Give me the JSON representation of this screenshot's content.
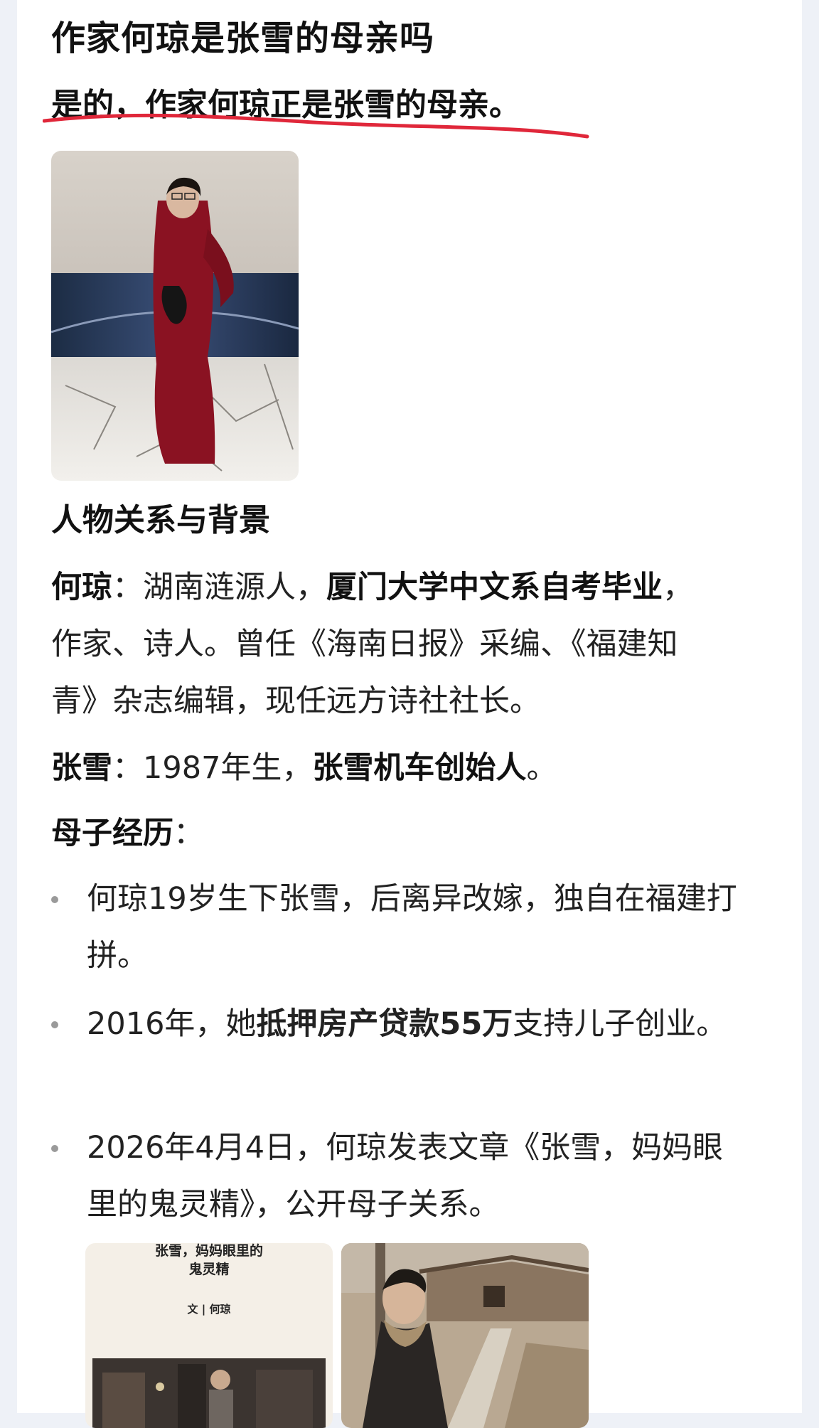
{
  "question": "作家何琼是张雪的母亲吗",
  "answer": "是的，作家何琼正是张雪的母亲。",
  "section_title": "人物关系与背景",
  "he_qiong": {
    "name": "何琼",
    "sep": "：",
    "text1": "湖南涟源人，",
    "bold": "厦门大学中文系自考毕业",
    "text2": "，作家、诗人。曾任《海南日报》采编、《福建知青》杂志编辑，现任远方诗社社长。"
  },
  "zhang_xue": {
    "name": "张雪",
    "sep": "：",
    "text1": "1987年生，",
    "bold": "张雪机车创始人",
    "text2": "。"
  },
  "experience": {
    "label": "母子经历",
    "sep": "："
  },
  "bullets": {
    "b1": "何琼19岁生下张雪，后离异改嫁，独自在福建打拼。",
    "b2_pre": "2016年，她",
    "b2_bold": "抵押房产贷款55万",
    "b2_post": "支持儿子创业。",
    "b3": "2026年4月4日，何琼发表文章《张雪，妈妈眼里的鬼灵精》，公开母子关系。"
  },
  "thumb_article": {
    "title_line1": "张雪，妈妈眼里的",
    "title_line2": "鬼灵精",
    "author": "文 | 何琼"
  },
  "colors": {
    "underline": "#e0273a",
    "background": "#eef1f7",
    "dress": "#8a1222"
  }
}
